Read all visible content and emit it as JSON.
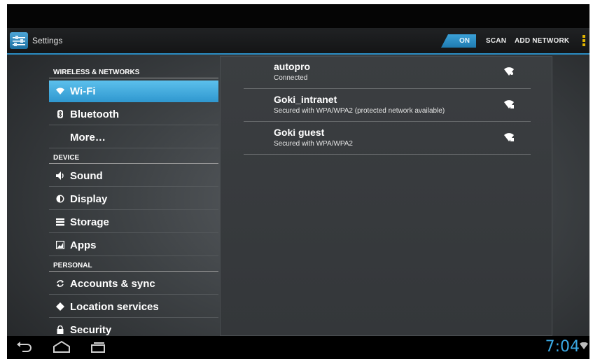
{
  "app": {
    "title": "Settings",
    "icon": "settings-sliders-icon"
  },
  "actionbar": {
    "toggle_label": "ON",
    "scan_label": "SCAN",
    "add_network_label": "ADD NETWORK",
    "overflow_icon": "overflow-menu-icon",
    "accent_color": "#2a8cc2",
    "overflow_color": "#e0b400"
  },
  "sidebar": {
    "categories": [
      {
        "header": "WIRELESS & NETWORKS"
      },
      {
        "header": "DEVICE"
      },
      {
        "header": "PERSONAL"
      }
    ],
    "items": [
      {
        "label": "Wi-Fi",
        "icon": "wifi-icon",
        "selected": true
      },
      {
        "label": "Bluetooth",
        "icon": "bluetooth-icon"
      },
      {
        "label": "More…",
        "icon": ""
      },
      {
        "label": "Sound",
        "icon": "speaker-icon"
      },
      {
        "label": "Display",
        "icon": "brightness-icon"
      },
      {
        "label": "Storage",
        "icon": "storage-icon"
      },
      {
        "label": "Apps",
        "icon": "apps-icon"
      },
      {
        "label": "Accounts & sync",
        "icon": "sync-icon"
      },
      {
        "label": "Location services",
        "icon": "location-icon"
      },
      {
        "label": "Security",
        "icon": "lock-icon"
      }
    ],
    "selected_color": "#33b5e5"
  },
  "networks": [
    {
      "name": "autopro",
      "status": "Connected",
      "icon": "wifi-signal-icon"
    },
    {
      "name": "Goki_intranet",
      "status": "Secured with WPA/WPA2 (protected network available)",
      "icon": "wifi-signal-locked-icon"
    },
    {
      "name": "Goki guest",
      "status": "Secured with WPA/WPA2",
      "icon": "wifi-signal-locked-icon"
    }
  ],
  "navbar": {
    "back_icon": "back-icon",
    "home_icon": "home-icon",
    "recents_icon": "recent-apps-icon",
    "clock": "7:04",
    "status_icon": "wifi-status-icon",
    "clock_color": "#3aa9e4"
  }
}
